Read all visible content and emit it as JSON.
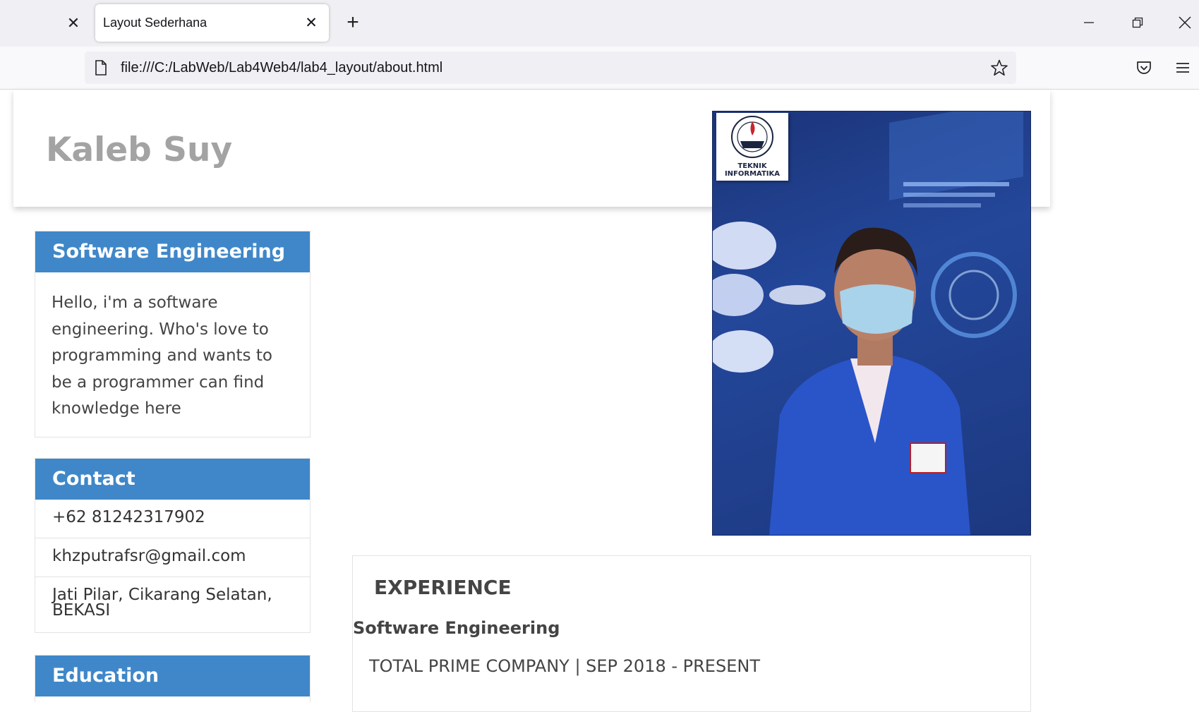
{
  "browser": {
    "tab_title": "Layout Sederhana",
    "url": "file:///C:/LabWeb/Lab4Web4/lab4_layout/about.html"
  },
  "header": {
    "site_title": "Kaleb Suy"
  },
  "photo": {
    "logo_text_line1": "TEKNIK",
    "logo_text_line2": "INFORMATIKA"
  },
  "sidebar": {
    "about": {
      "heading": "Software Engineering",
      "text": "Hello, i'm a software engineering. Who's love to programming and wants to be a programmer can find knowledge here"
    },
    "contact": {
      "heading": "Contact",
      "phone": "+62 81242317902",
      "email": "khzputrafsr@gmail.com",
      "address": "Jati Pilar, Cikarang Selatan, BEKASI"
    },
    "education": {
      "heading": "Education"
    }
  },
  "experience": {
    "title": "EXPERIENCE",
    "role": "Software Engineering",
    "company_period": "TOTAL PRIME COMPANY | SEP 2018 - PRESENT"
  },
  "colors": {
    "accent": "#3f87c8",
    "title_gray": "#a3a3a3"
  }
}
